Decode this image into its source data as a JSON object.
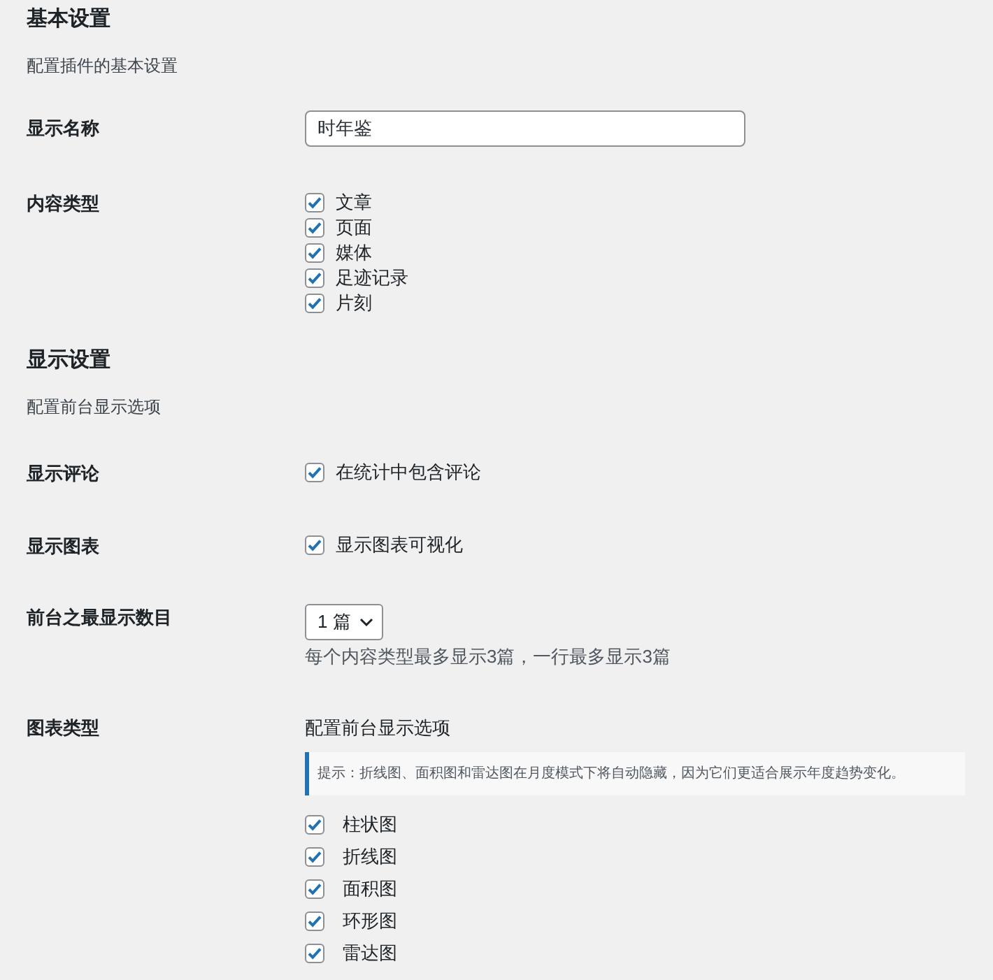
{
  "sections": [
    {
      "title": "基本设置",
      "description": "配置插件的基本设置",
      "fields": [
        {
          "label": "显示名称",
          "kind": "text",
          "value": "时年鉴"
        },
        {
          "label": "内容类型",
          "kind": "checkbox_list",
          "options": [
            {
              "label": "文章",
              "checked": true
            },
            {
              "label": "页面",
              "checked": true
            },
            {
              "label": "媒体",
              "checked": true
            },
            {
              "label": "足迹记录",
              "checked": true
            },
            {
              "label": "片刻",
              "checked": true
            }
          ]
        }
      ]
    },
    {
      "title": "显示设置",
      "description": "配置前台显示选项",
      "fields": [
        {
          "label": "显示评论",
          "kind": "checkbox",
          "option": {
            "label": "在统计中包含评论",
            "checked": true
          }
        },
        {
          "label": "显示图表",
          "kind": "checkbox",
          "option": {
            "label": "显示图表可视化",
            "checked": true
          }
        },
        {
          "label": "前台之最显示数目",
          "kind": "select",
          "value": "1 篇",
          "help": "每个内容类型最多显示3篇，一行最多显示3篇"
        },
        {
          "label": "图表类型",
          "kind": "chart_types",
          "description": "配置前台显示选项",
          "notice": "提示：折线图、面积图和雷达图在月度模式下将自动隐藏，因为它们更适合展示年度趋势变化。",
          "options": [
            {
              "label": "柱状图",
              "checked": true
            },
            {
              "label": "折线图",
              "checked": true
            },
            {
              "label": "面积图",
              "checked": true
            },
            {
              "label": "环形图",
              "checked": true
            },
            {
              "label": "雷达图",
              "checked": true
            }
          ]
        }
      ]
    }
  ]
}
